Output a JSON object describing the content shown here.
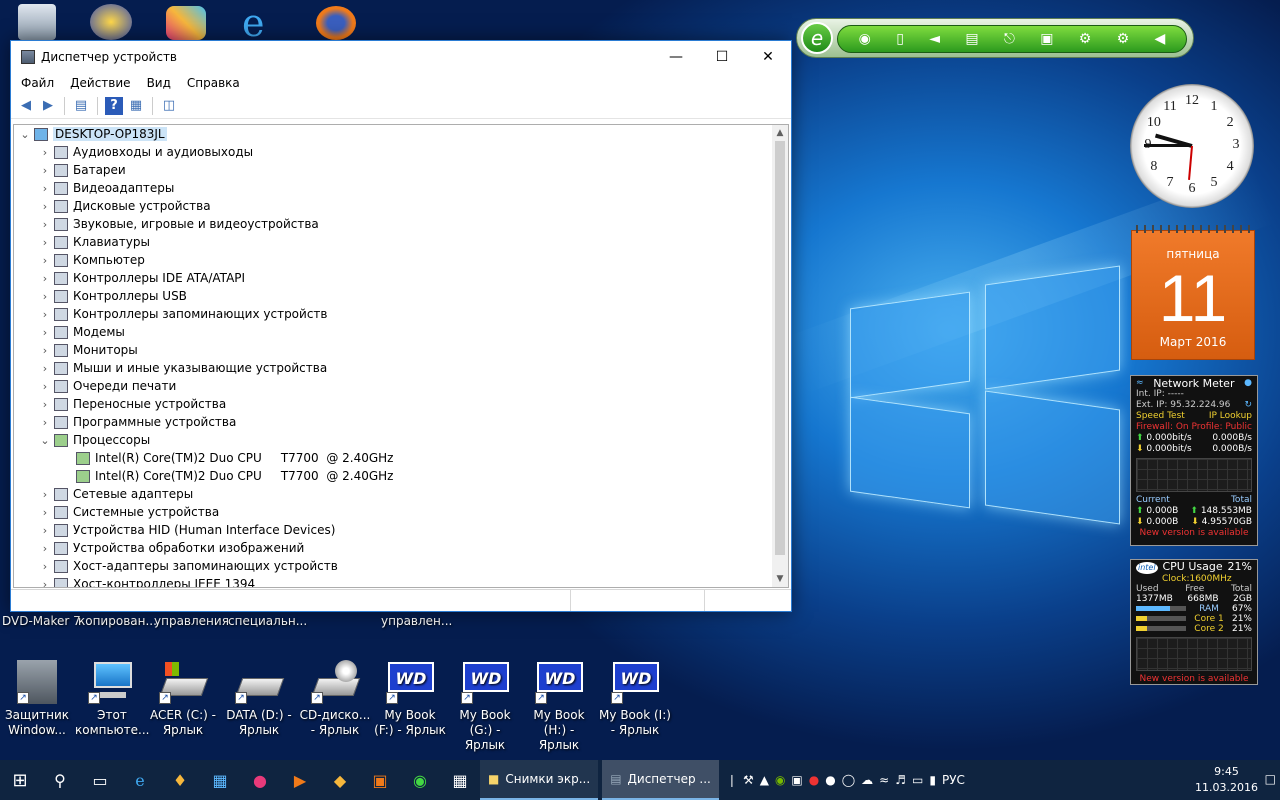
{
  "desktop": {
    "top_labels": [
      "DVD-Maker 7",
      "копирован...",
      "управления",
      "специальн...",
      "управлен..."
    ],
    "icons": [
      {
        "label": "Защитник Window...",
        "icon": "shield-wall-icon"
      },
      {
        "label": "Этот компьюте...",
        "icon": "computer-icon"
      },
      {
        "label": "ACER (C:) - Ярлык",
        "icon": "drive-icon"
      },
      {
        "label": "DATA (D:) - Ярлык",
        "icon": "drive-icon"
      },
      {
        "label": "CD-диско... - Ярлык",
        "icon": "dvd-drive-icon"
      },
      {
        "label": "My Book (F:) - Ярлык",
        "icon": "wd-icon"
      },
      {
        "label": "My Book (G:) - Ярлык",
        "icon": "wd-icon"
      },
      {
        "label": "My Book (H:) - Ярлык",
        "icon": "wd-icon"
      },
      {
        "label": "My Book (I:) - Ярлык",
        "icon": "wd-icon"
      }
    ]
  },
  "window": {
    "title": "Диспетчер устройств",
    "menu": [
      "Файл",
      "Действие",
      "Вид",
      "Справка"
    ],
    "root": "DESKTOP-OP183JL",
    "tree": [
      {
        "label": "Аудиовходы и аудиовыходы",
        "expanded": false
      },
      {
        "label": "Батареи",
        "expanded": false
      },
      {
        "label": "Видеоадаптеры",
        "expanded": false
      },
      {
        "label": "Дисковые устройства",
        "expanded": false
      },
      {
        "label": "Звуковые, игровые и видеоустройства",
        "expanded": false
      },
      {
        "label": "Клавиатуры",
        "expanded": false
      },
      {
        "label": "Компьютер",
        "expanded": false
      },
      {
        "label": "Контроллеры IDE ATA/ATAPI",
        "expanded": false
      },
      {
        "label": "Контроллеры USB",
        "expanded": false
      },
      {
        "label": "Контроллеры запоминающих устройств",
        "expanded": false
      },
      {
        "label": "Модемы",
        "expanded": false
      },
      {
        "label": "Мониторы",
        "expanded": false
      },
      {
        "label": "Мыши и иные указывающие устройства",
        "expanded": false
      },
      {
        "label": "Очереди печати",
        "expanded": false
      },
      {
        "label": "Переносные устройства",
        "expanded": false
      },
      {
        "label": "Программные устройства",
        "expanded": false
      },
      {
        "label": "Процессоры",
        "expanded": true
      },
      {
        "label": "Intel(R) Core(TM)2 Duo CPU     T7700  @ 2.40GHz",
        "child": true
      },
      {
        "label": "Intel(R) Core(TM)2 Duo CPU     T7700  @ 2.40GHz",
        "child": true
      },
      {
        "label": "Сетевые адаптеры",
        "expanded": false
      },
      {
        "label": "Системные устройства",
        "expanded": false
      },
      {
        "label": "Устройства HID (Human Interface Devices)",
        "expanded": false
      },
      {
        "label": "Устройства обработки изображений",
        "expanded": false
      },
      {
        "label": "Хост-адаптеры запоминающих устройств",
        "expanded": false
      },
      {
        "label": "Хост-контроллеры IEEE 1394",
        "expanded": false
      }
    ]
  },
  "calendar": {
    "day": "пятница",
    "date": "11",
    "month": "Март 2016"
  },
  "clock_numbers": [
    "12",
    "1",
    "2",
    "3",
    "4",
    "5",
    "6",
    "7",
    "8",
    "9",
    "10",
    "11"
  ],
  "network": {
    "title": "Network Meter",
    "int_ip": "Int. IP: -----",
    "ext_ip": "Ext. IP: 95.32.224.96",
    "speed_test": "Speed Test",
    "ip_lookup": "IP Lookup",
    "firewall": "Firewall: On",
    "profile": "Profile: Public",
    "up_rate_bits": "0.000bit/s",
    "up_rate_bytes": "0.000B/s",
    "down_rate_bits": "0.000bit/s",
    "down_rate_bytes": "0.000B/s",
    "current": "Current",
    "total": "Total",
    "cur_up": "0.000B",
    "cur_down": "0.000B",
    "tot_up": "148.553MB",
    "tot_down": "4.95570GB",
    "notice": "New version is available"
  },
  "cpu": {
    "title": "CPU Usage",
    "percent": "21%",
    "clock": "Clock:1600MHz",
    "used_label": "Used",
    "free_label": "Free",
    "total_label": "Total",
    "used": "1377MB",
    "free": "668MB",
    "total": "2GB",
    "ram_label": "RAM",
    "ram": "67%",
    "core1_label": "Core 1",
    "core1": "21%",
    "core2_label": "Core 2",
    "core2": "21%",
    "notice": "New version is available"
  },
  "taskbar": {
    "windows": [
      "Снимки экр...",
      "Диспетчер ..."
    ],
    "lang": "РУС",
    "time": "9:45",
    "date": "11.03.2016"
  }
}
